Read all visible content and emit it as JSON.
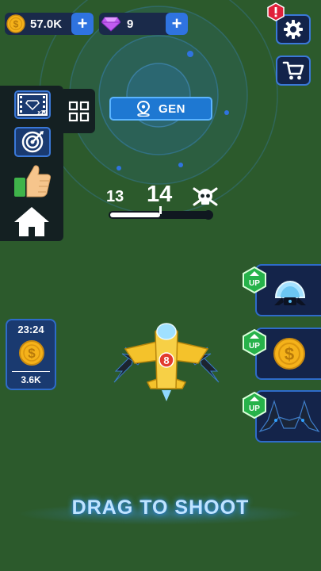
{
  "currency": {
    "coins": "57.0K",
    "gems": "9"
  },
  "gen_button_label": "GEN",
  "level": {
    "previous": "13",
    "current": "14",
    "progress": 0.5
  },
  "upgrades": {
    "badge_label": "UP",
    "items": [
      "shield-upgrade",
      "coin-upgrade",
      "wing-upgrade"
    ]
  },
  "timer": {
    "time": "23:24",
    "reward": "3.6K"
  },
  "video_badge": "x10",
  "hint_text": "DRAG TO SHOOT",
  "plane_number": "8",
  "colors": {
    "background": "#2c5a2c",
    "accent_blue": "#2f73e0",
    "panel_dark": "#142022",
    "card_navy": "#14244a",
    "up_green": "#27b24a",
    "alert_red": "#e0213a",
    "coin_gold": "#f5b21a",
    "gem_purple": "#b54fe6"
  }
}
